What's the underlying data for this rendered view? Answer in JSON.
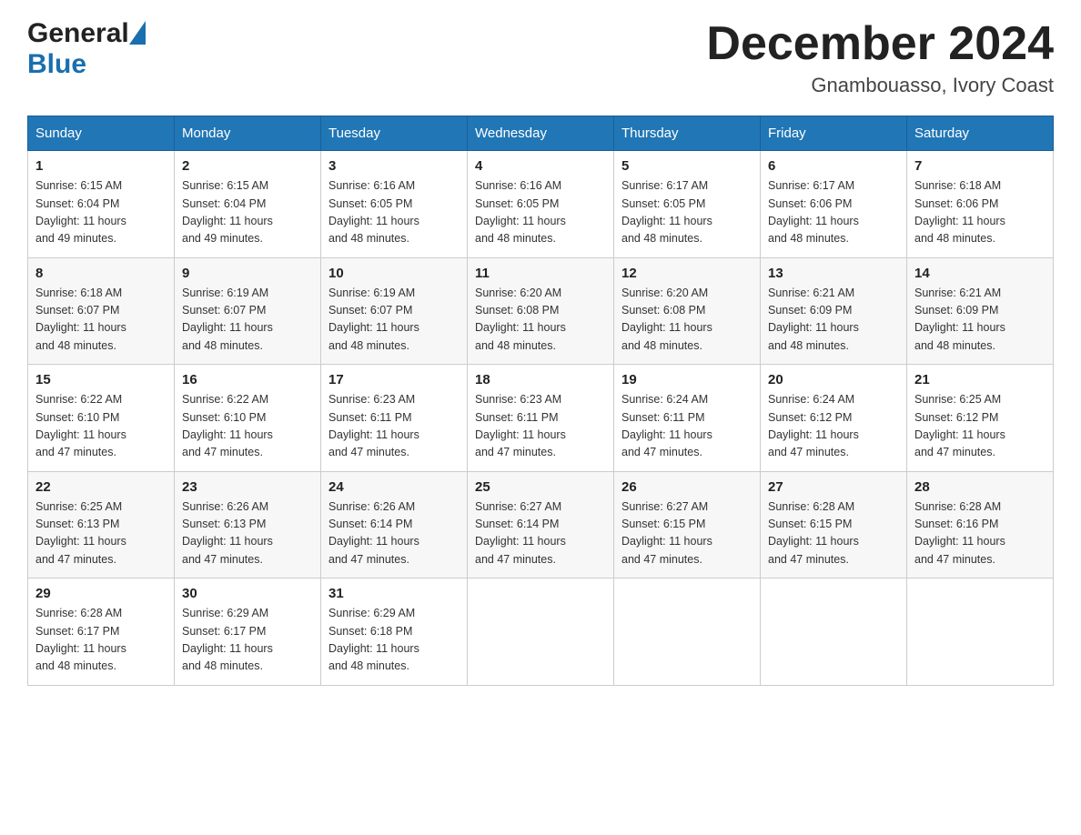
{
  "logo": {
    "general": "General",
    "blue": "Blue"
  },
  "title": {
    "month": "December 2024",
    "location": "Gnambouasso, Ivory Coast"
  },
  "weekdays": [
    "Sunday",
    "Monday",
    "Tuesday",
    "Wednesday",
    "Thursday",
    "Friday",
    "Saturday"
  ],
  "weeks": [
    [
      {
        "day": "1",
        "sunrise": "6:15 AM",
        "sunset": "6:04 PM",
        "daylight": "11 hours and 49 minutes."
      },
      {
        "day": "2",
        "sunrise": "6:15 AM",
        "sunset": "6:04 PM",
        "daylight": "11 hours and 49 minutes."
      },
      {
        "day": "3",
        "sunrise": "6:16 AM",
        "sunset": "6:05 PM",
        "daylight": "11 hours and 48 minutes."
      },
      {
        "day": "4",
        "sunrise": "6:16 AM",
        "sunset": "6:05 PM",
        "daylight": "11 hours and 48 minutes."
      },
      {
        "day": "5",
        "sunrise": "6:17 AM",
        "sunset": "6:05 PM",
        "daylight": "11 hours and 48 minutes."
      },
      {
        "day": "6",
        "sunrise": "6:17 AM",
        "sunset": "6:06 PM",
        "daylight": "11 hours and 48 minutes."
      },
      {
        "day": "7",
        "sunrise": "6:18 AM",
        "sunset": "6:06 PM",
        "daylight": "11 hours and 48 minutes."
      }
    ],
    [
      {
        "day": "8",
        "sunrise": "6:18 AM",
        "sunset": "6:07 PM",
        "daylight": "11 hours and 48 minutes."
      },
      {
        "day": "9",
        "sunrise": "6:19 AM",
        "sunset": "6:07 PM",
        "daylight": "11 hours and 48 minutes."
      },
      {
        "day": "10",
        "sunrise": "6:19 AM",
        "sunset": "6:07 PM",
        "daylight": "11 hours and 48 minutes."
      },
      {
        "day": "11",
        "sunrise": "6:20 AM",
        "sunset": "6:08 PM",
        "daylight": "11 hours and 48 minutes."
      },
      {
        "day": "12",
        "sunrise": "6:20 AM",
        "sunset": "6:08 PM",
        "daylight": "11 hours and 48 minutes."
      },
      {
        "day": "13",
        "sunrise": "6:21 AM",
        "sunset": "6:09 PM",
        "daylight": "11 hours and 48 minutes."
      },
      {
        "day": "14",
        "sunrise": "6:21 AM",
        "sunset": "6:09 PM",
        "daylight": "11 hours and 48 minutes."
      }
    ],
    [
      {
        "day": "15",
        "sunrise": "6:22 AM",
        "sunset": "6:10 PM",
        "daylight": "11 hours and 47 minutes."
      },
      {
        "day": "16",
        "sunrise": "6:22 AM",
        "sunset": "6:10 PM",
        "daylight": "11 hours and 47 minutes."
      },
      {
        "day": "17",
        "sunrise": "6:23 AM",
        "sunset": "6:11 PM",
        "daylight": "11 hours and 47 minutes."
      },
      {
        "day": "18",
        "sunrise": "6:23 AM",
        "sunset": "6:11 PM",
        "daylight": "11 hours and 47 minutes."
      },
      {
        "day": "19",
        "sunrise": "6:24 AM",
        "sunset": "6:11 PM",
        "daylight": "11 hours and 47 minutes."
      },
      {
        "day": "20",
        "sunrise": "6:24 AM",
        "sunset": "6:12 PM",
        "daylight": "11 hours and 47 minutes."
      },
      {
        "day": "21",
        "sunrise": "6:25 AM",
        "sunset": "6:12 PM",
        "daylight": "11 hours and 47 minutes."
      }
    ],
    [
      {
        "day": "22",
        "sunrise": "6:25 AM",
        "sunset": "6:13 PM",
        "daylight": "11 hours and 47 minutes."
      },
      {
        "day": "23",
        "sunrise": "6:26 AM",
        "sunset": "6:13 PM",
        "daylight": "11 hours and 47 minutes."
      },
      {
        "day": "24",
        "sunrise": "6:26 AM",
        "sunset": "6:14 PM",
        "daylight": "11 hours and 47 minutes."
      },
      {
        "day": "25",
        "sunrise": "6:27 AM",
        "sunset": "6:14 PM",
        "daylight": "11 hours and 47 minutes."
      },
      {
        "day": "26",
        "sunrise": "6:27 AM",
        "sunset": "6:15 PM",
        "daylight": "11 hours and 47 minutes."
      },
      {
        "day": "27",
        "sunrise": "6:28 AM",
        "sunset": "6:15 PM",
        "daylight": "11 hours and 47 minutes."
      },
      {
        "day": "28",
        "sunrise": "6:28 AM",
        "sunset": "6:16 PM",
        "daylight": "11 hours and 47 minutes."
      }
    ],
    [
      {
        "day": "29",
        "sunrise": "6:28 AM",
        "sunset": "6:17 PM",
        "daylight": "11 hours and 48 minutes."
      },
      {
        "day": "30",
        "sunrise": "6:29 AM",
        "sunset": "6:17 PM",
        "daylight": "11 hours and 48 minutes."
      },
      {
        "day": "31",
        "sunrise": "6:29 AM",
        "sunset": "6:18 PM",
        "daylight": "11 hours and 48 minutes."
      },
      null,
      null,
      null,
      null
    ]
  ],
  "labels": {
    "sunrise": "Sunrise:",
    "sunset": "Sunset:",
    "daylight": "Daylight:"
  }
}
